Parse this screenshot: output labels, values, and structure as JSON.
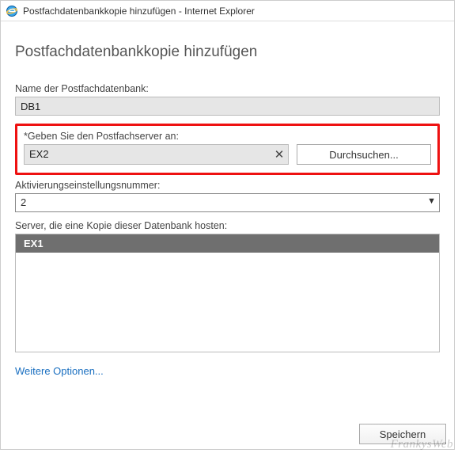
{
  "window": {
    "title": "Postfachdatenbankkopie hinzufügen - Internet Explorer"
  },
  "page": {
    "heading": "Postfachdatenbankkopie hinzufügen"
  },
  "db_name": {
    "label": "Name der Postfachdatenbank:",
    "value": "DB1"
  },
  "mailbox_server": {
    "label": "*Geben Sie den Postfachserver an:",
    "value": "EX2",
    "browse_label": "Durchsuchen..."
  },
  "activation_pref": {
    "label": "Aktivierungseinstellungsnummer:",
    "value": "2"
  },
  "hosting_servers": {
    "label": "Server, die eine Kopie dieser Datenbank hosten:",
    "items": [
      "EX1"
    ]
  },
  "more_options": "Weitere Optionen...",
  "buttons": {
    "save": "Speichern"
  },
  "watermark": "FrankysWeb"
}
